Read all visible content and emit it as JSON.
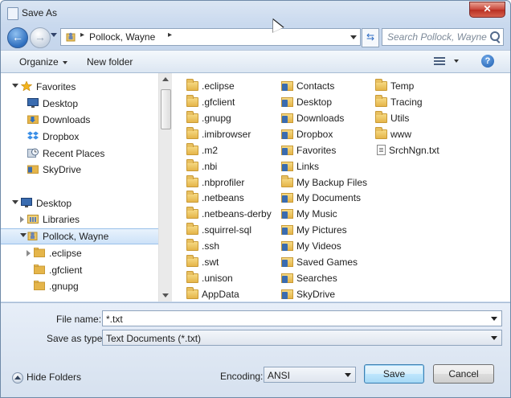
{
  "window": {
    "title": "Save As",
    "close_glyph": "✕"
  },
  "nav": {
    "back_glyph": "←",
    "forward_glyph": "→",
    "breadcrumb": "Pollock, Wayne",
    "breadcrumb_separator": "▸",
    "refresh_glyph": "⇆",
    "search_placeholder": "Search Pollock, Wayne"
  },
  "toolbar": {
    "organize": "Organize",
    "new_folder": "New folder",
    "help_glyph": "?"
  },
  "sidebar": {
    "items": [
      {
        "label": "Favorites",
        "icon": "star-icon",
        "color": "#f2b31e"
      },
      {
        "label": "Desktop",
        "icon": "desktop-icon",
        "color": "#3a6cb0"
      },
      {
        "label": "Downloads",
        "icon": "downloads-folder-icon",
        "color": "#e5b54a"
      },
      {
        "label": "Dropbox",
        "icon": "dropbox-icon",
        "color": "#3a8ee6"
      },
      {
        "label": "Recent Places",
        "icon": "recent-places-icon",
        "color": "#7a8fa8"
      },
      {
        "label": "SkyDrive",
        "icon": "skydrive-icon",
        "color": "#e5b54a"
      },
      {
        "label": "Desktop",
        "icon": "desktop-icon",
        "color": "#3a6cb0"
      },
      {
        "label": "Libraries",
        "icon": "libraries-icon",
        "color": "#e5b54a"
      },
      {
        "label": "Pollock, Wayne",
        "icon": "user-folder-icon",
        "color": "#c99a35"
      },
      {
        "label": ".eclipse",
        "icon": "folder-icon",
        "color": "#e5b54a"
      },
      {
        "label": ".gfclient",
        "icon": "folder-icon",
        "color": "#e5b54a"
      },
      {
        "label": ".gnupg",
        "icon": "folder-icon",
        "color": "#e5b54a"
      }
    ]
  },
  "files": {
    "col1": [
      ".eclipse",
      ".gfclient",
      ".gnupg",
      ".imibrowser",
      ".m2",
      ".nbi",
      ".nbprofiler",
      ".netbeans",
      ".netbeans-derby",
      ".squirrel-sql",
      ".ssh",
      ".swt",
      ".unison",
      "AppData"
    ],
    "col2": [
      "Contacts",
      "Desktop",
      "Downloads",
      "Dropbox",
      "Favorites",
      "Links",
      "My Backup Files",
      "My Documents",
      "My Music",
      "My Pictures",
      "My Videos",
      "Saved Games",
      "Searches",
      "SkyDrive"
    ],
    "col3": [
      "Temp",
      "Tracing",
      "Utils",
      "www",
      "SrchNgn.txt"
    ]
  },
  "form": {
    "file_name_label": "File name:",
    "file_name_value": "*.txt",
    "save_type_label": "Save as type:",
    "save_type_value": "Text Documents (*.txt)",
    "encoding_label": "Encoding:",
    "encoding_value": "ANSI",
    "save_button": "Save",
    "cancel_button": "Cancel",
    "hide_folders": "Hide Folders"
  }
}
